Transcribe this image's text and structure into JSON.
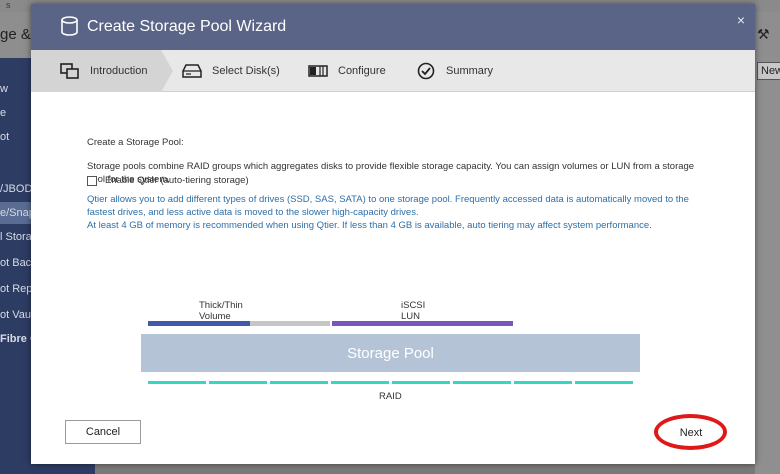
{
  "background": {
    "top_text": "s",
    "title_fragment": "ge &",
    "right_button_label": "New",
    "sidebar_items": [
      {
        "label": "w"
      },
      {
        "label": "e"
      },
      {
        "label": "ot"
      },
      {
        "label": "/JBOD"
      },
      {
        "label": "e/Snap"
      },
      {
        "label": "l Stora"
      },
      {
        "label": "ot Bac"
      },
      {
        "label": "ot Rep"
      },
      {
        "label": "ot Vau"
      },
      {
        "label": "Fibre C"
      }
    ]
  },
  "modal": {
    "title": "Create Storage Pool Wizard",
    "close_glyph": "×",
    "steps": [
      {
        "label": "Introduction",
        "icon": "storage-pool-icon",
        "active": true
      },
      {
        "label": "Select Disk(s)",
        "icon": "disk-drive-icon",
        "active": false
      },
      {
        "label": "Configure",
        "icon": "configure-icon",
        "active": false
      },
      {
        "label": "Summary",
        "icon": "check-circle-icon",
        "active": false
      }
    ],
    "heading": "Create a Storage Pool:",
    "description": "Storage pools combine RAID groups which aggregates disks to provide flexible storage capacity. You can assign volumes or LUN from a storage pool for the system.",
    "qtier_checkbox_label": "Enable Qtier (auto-tiering storage)",
    "qtier_checked": false,
    "qtier_info_line1": "Qtier allows you to add different types of drives (SSD, SAS, SATA) to one storage pool. Frequently accessed data is automatically moved to the fastest drives, and less active data is moved to the slower high-capacity drives.",
    "qtier_info_line2": "At least 4 GB of memory is recommended when using Qtier. If less than 4 GB is available, auto tiering may affect system performance.",
    "diagram": {
      "volume_label": "Thick/Thin Volume",
      "lun_label": "iSCSI LUN",
      "pool_label": "Storage Pool",
      "raid_label": "RAID",
      "colors": {
        "volume": "#3f5aa8",
        "volume_free": "#c6c6c6",
        "lun": "#7a55c0",
        "pool": "#b5c3d6",
        "raid": "#35d6c2"
      }
    },
    "cancel_label": "Cancel",
    "next_label": "Next",
    "colors": {
      "header": "#5a6486",
      "steps_bar": "#e8e8e8",
      "info_text": "#2e6fa8",
      "highlight_ring": "#e01818"
    }
  }
}
